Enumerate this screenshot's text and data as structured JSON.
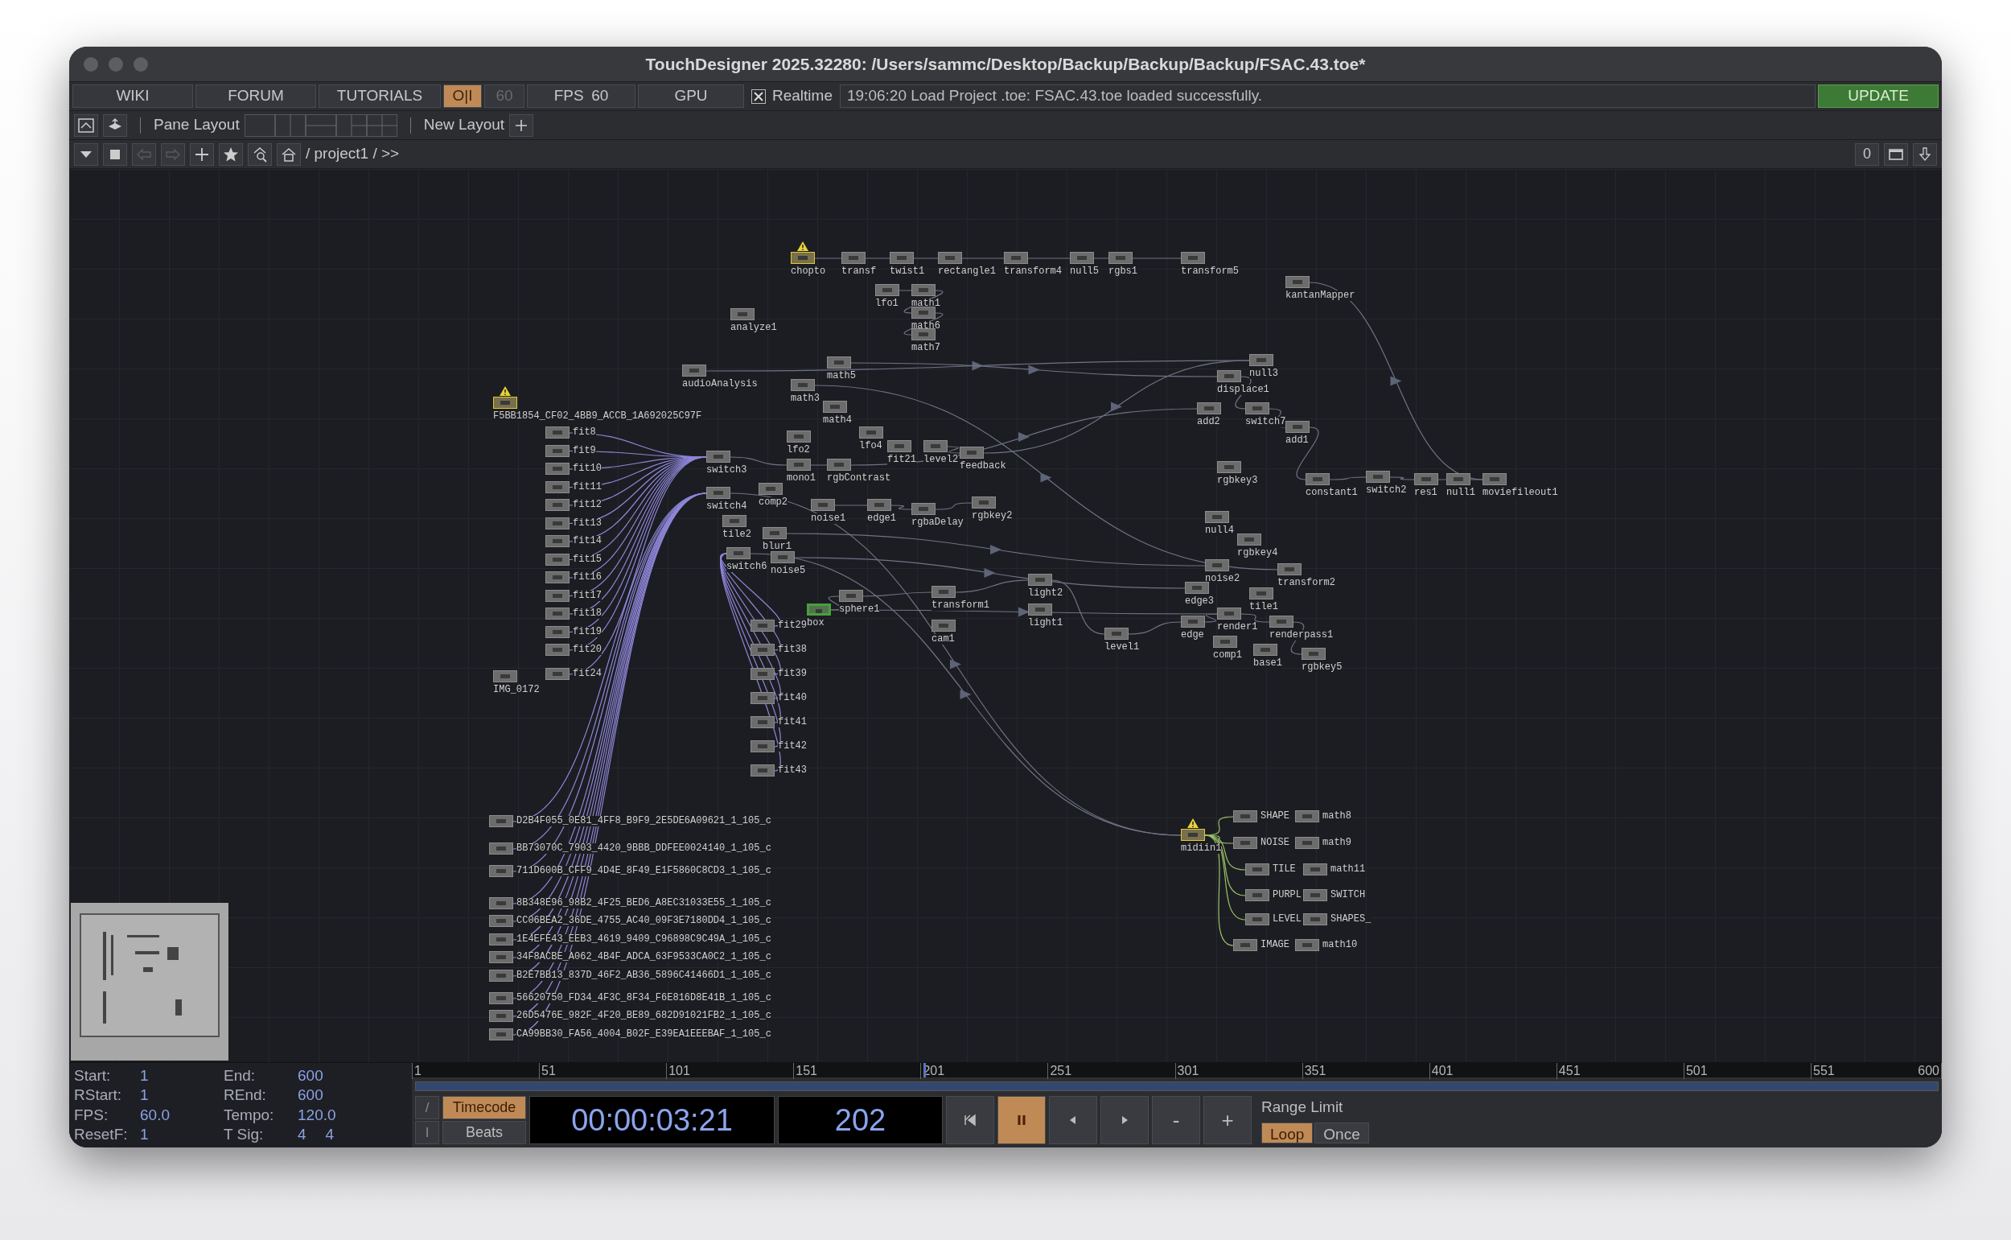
{
  "window": {
    "title": "TouchDesigner 2025.32280: /Users/sammc/Desktop/Backup/Backup/Backup/FSAC.43.toe*"
  },
  "toolbar": {
    "links": [
      "WIKI",
      "FORUM",
      "TUTORIALS"
    ],
    "perform_toggle": {
      "label": "O|I",
      "on": true
    },
    "frame_rate_field": {
      "value": "60",
      "disabled": true
    },
    "fps": {
      "label": "FPS",
      "value": "60"
    },
    "gpu": {
      "label": "GPU"
    },
    "realtime": {
      "label": "Realtime",
      "checked": true
    },
    "message": "19:06:20 Load Project .toe: FSAC.43.toe loaded successfully.",
    "update_button": {
      "label": "UPDATE"
    }
  },
  "pane_bar": {
    "label": "Pane Layout",
    "new_layout": "New Layout"
  },
  "path_bar": {
    "path": "/ project1 / >>",
    "back_disabled": true,
    "forward_disabled": true,
    "counter": "0"
  },
  "graph": {
    "nodes": [
      {
        "label": "chopto",
        "warning": true,
        "selected": false
      },
      {
        "label": "transf",
        "warning": false,
        "selected": false
      },
      {
        "label": "twist1",
        "warning": false,
        "selected": false
      },
      {
        "label": "rectangle1",
        "warning": false,
        "selected": false
      },
      {
        "label": "transform4",
        "warning": false,
        "selected": false
      },
      {
        "label": "null5",
        "warning": false,
        "selected": false
      },
      {
        "label": "rgbs1",
        "warning": false,
        "selected": false
      },
      {
        "label": "transform5",
        "warning": false,
        "selected": false
      },
      {
        "label": "kantanMapper",
        "warning": false,
        "selected": false
      },
      {
        "label": "lfo1",
        "warning": false,
        "selected": false
      },
      {
        "label": "math1",
        "warning": false,
        "selected": false
      },
      {
        "label": "math6",
        "warning": false,
        "selected": false
      },
      {
        "label": "math7",
        "warning": false,
        "selected": false
      },
      {
        "label": "analyze1",
        "warning": false,
        "selected": false
      },
      {
        "label": "audioAnalysis",
        "warning": false,
        "selected": false
      },
      {
        "label": "math5",
        "warning": false,
        "selected": false
      },
      {
        "label": "math3",
        "warning": false,
        "selected": false
      },
      {
        "label": "math4",
        "warning": false,
        "selected": false
      },
      {
        "label": "lfo2",
        "warning": false,
        "selected": false
      },
      {
        "label": "lfo4",
        "warning": false,
        "selected": false
      },
      {
        "label": "fit21",
        "warning": false,
        "selected": false
      },
      {
        "label": "level2",
        "warning": false,
        "selected": false
      },
      {
        "label": "feedback",
        "warning": false,
        "selected": false
      },
      {
        "label": "switch3",
        "warning": false,
        "selected": false
      },
      {
        "label": "mono1",
        "warning": false,
        "selected": false
      },
      {
        "label": "rgbContrast",
        "warning": false,
        "selected": false
      },
      {
        "label": "switch4",
        "warning": false,
        "selected": false
      },
      {
        "label": "comp2",
        "warning": false,
        "selected": false
      },
      {
        "label": "tile2",
        "warning": false,
        "selected": false
      },
      {
        "label": "noise1",
        "warning": false,
        "selected": false
      },
      {
        "label": "edge1",
        "warning": false,
        "selected": false
      },
      {
        "label": "rgbaDelay",
        "warning": false,
        "selected": false
      },
      {
        "label": "rgbkey2",
        "warning": false,
        "selected": false
      },
      {
        "label": "blur1",
        "warning": false,
        "selected": false
      },
      {
        "label": "switch6",
        "warning": false,
        "selected": false
      },
      {
        "label": "noise5",
        "warning": false,
        "selected": false
      },
      {
        "label": "box",
        "warning": false,
        "selected": true
      },
      {
        "label": "sphere1",
        "warning": false,
        "selected": false
      },
      {
        "label": "transform1",
        "warning": false,
        "selected": false
      },
      {
        "label": "cam1",
        "warning": false,
        "selected": false
      },
      {
        "label": "light2",
        "warning": false,
        "selected": false
      },
      {
        "label": "light1",
        "warning": false,
        "selected": false
      },
      {
        "label": "level1",
        "warning": false,
        "selected": false
      },
      {
        "label": "null3",
        "warning": false,
        "selected": false
      },
      {
        "label": "displace1",
        "warning": false,
        "selected": false
      },
      {
        "label": "add2",
        "warning": false,
        "selected": false
      },
      {
        "label": "switch7",
        "warning": false,
        "selected": false
      },
      {
        "label": "add1",
        "warning": false,
        "selected": false
      },
      {
        "label": "rgbkey3",
        "warning": false,
        "selected": false
      },
      {
        "label": "constant1",
        "warning": false,
        "selected": false
      },
      {
        "label": "switch2",
        "warning": false,
        "selected": false
      },
      {
        "label": "res1",
        "warning": false,
        "selected": false
      },
      {
        "label": "null1",
        "warning": false,
        "selected": false
      },
      {
        "label": "moviefileout1",
        "warning": false,
        "selected": false
      },
      {
        "label": "null4",
        "warning": false,
        "selected": false
      },
      {
        "label": "rgbkey4",
        "warning": false,
        "selected": false
      },
      {
        "label": "noise2",
        "warning": false,
        "selected": false
      },
      {
        "label": "transform2",
        "warning": false,
        "selected": false
      },
      {
        "label": "edge3",
        "warning": false,
        "selected": false
      },
      {
        "label": "tile1",
        "warning": false,
        "selected": false
      },
      {
        "label": "render1",
        "warning": false,
        "selected": false
      },
      {
        "label": "edge",
        "warning": false,
        "selected": false
      },
      {
        "label": "renderpass1",
        "warning": false,
        "selected": false
      },
      {
        "label": "comp1",
        "warning": false,
        "selected": false
      },
      {
        "label": "base1",
        "warning": false,
        "selected": false
      },
      {
        "label": "rgbkey5",
        "warning": false,
        "selected": false
      },
      {
        "label": "F5BB1854_CF02_4BB9_ACCB_1A692025C97F",
        "warning": true,
        "selected": false
      },
      {
        "label": "fit8",
        "warning": false,
        "selected": false
      },
      {
        "label": "fit9",
        "warning": false,
        "selected": false
      },
      {
        "label": "fit10",
        "warning": false,
        "selected": false
      },
      {
        "label": "fit11",
        "warning": false,
        "selected": false
      },
      {
        "label": "fit12",
        "warning": false,
        "selected": false
      },
      {
        "label": "fit13",
        "warning": false,
        "selected": false
      },
      {
        "label": "fit14",
        "warning": false,
        "selected": false
      },
      {
        "label": "fit15",
        "warning": false,
        "selected": false
      },
      {
        "label": "fit16",
        "warning": false,
        "selected": false
      },
      {
        "label": "fit17",
        "warning": false,
        "selected": false
      },
      {
        "label": "fit18",
        "warning": false,
        "selected": false
      },
      {
        "label": "fit19",
        "warning": false,
        "selected": false
      },
      {
        "label": "fit20",
        "warning": false,
        "selected": false
      },
      {
        "label": "fit24",
        "warning": false,
        "selected": false
      },
      {
        "label": "IMG_0172",
        "warning": false,
        "selected": false
      },
      {
        "label": "fit29",
        "warning": false,
        "selected": false
      },
      {
        "label": "fit38",
        "warning": false,
        "selected": false
      },
      {
        "label": "fit39",
        "warning": false,
        "selected": false
      },
      {
        "label": "fit40",
        "warning": false,
        "selected": false
      },
      {
        "label": "fit41",
        "warning": false,
        "selected": false
      },
      {
        "label": "fit42",
        "warning": false,
        "selected": false
      },
      {
        "label": "fit43",
        "warning": false,
        "selected": false
      },
      {
        "label": "D2B4F055_0E81_4FF8_B9F9_2E5DE6A09621_1_105_c",
        "warning": false,
        "selected": false
      },
      {
        "label": "BB73070C_7903_4420_9BBB_DDFEE0024140_1_105_c",
        "warning": false,
        "selected": false
      },
      {
        "label": "711D600B_CFF9_4D4E_8F49_E1F5860C8CD3_1_105_c",
        "warning": false,
        "selected": false
      },
      {
        "label": "8B348E96_98B2_4F25_BED6_A8EC31033E55_1_105_c",
        "warning": false,
        "selected": false
      },
      {
        "label": "CC06BEA2_36DE_4755_AC40_09F3E7180DD4_1_105_c",
        "warning": false,
        "selected": false
      },
      {
        "label": "1E4EFE43_EEB3_4619_9409_C96898C9C49A_1_105_c",
        "warning": false,
        "selected": false
      },
      {
        "label": "34F8ACBE_A062_4B4F_ADCA_63F9533CA0C2_1_105_c",
        "warning": false,
        "selected": false
      },
      {
        "label": "B2E7BB13_837D_46F2_AB36_5896C41466D1_1_105_c",
        "warning": false,
        "selected": false
      },
      {
        "label": "56620750_FD34_4F3C_8F34_F6E816D8E41B_1_105_c",
        "warning": false,
        "selected": false
      },
      {
        "label": "26D5476E_982F_4F20_BE89_682D91021FB2_1_105_c",
        "warning": false,
        "selected": false
      },
      {
        "label": "CA99BB30_FA56_4004_B02F_E39EA1EEEBAF_1_105_c",
        "warning": false,
        "selected": false
      },
      {
        "label": "midiin1",
        "warning": true,
        "selected": false
      },
      {
        "label": "SHAPE",
        "warning": false,
        "selected": false
      },
      {
        "label": "math8",
        "warning": false,
        "selected": false
      },
      {
        "label": "NOISE",
        "warning": false,
        "selected": false
      },
      {
        "label": "math9",
        "warning": false,
        "selected": false
      },
      {
        "label": "TILE",
        "warning": false,
        "selected": false
      },
      {
        "label": "math11",
        "warning": false,
        "selected": false
      },
      {
        "label": "PURPL",
        "warning": false,
        "selected": false
      },
      {
        "label": "SWITCH",
        "warning": false,
        "selected": false
      },
      {
        "label": "LEVEL",
        "warning": false,
        "selected": false
      },
      {
        "label": "SHAPES_",
        "warning": false,
        "selected": false
      },
      {
        "label": "IMAGE",
        "warning": false,
        "selected": false
      },
      {
        "label": "math10",
        "warning": false,
        "selected": false
      }
    ]
  },
  "info": [
    {
      "label": "Start:",
      "values": [
        "1"
      ]
    },
    {
      "label": "End:",
      "values": [
        "600"
      ]
    },
    {
      "label": "RStart:",
      "values": [
        "1"
      ]
    },
    {
      "label": "REnd:",
      "values": [
        "600"
      ]
    },
    {
      "label": "FPS:",
      "values": [
        "60.0"
      ]
    },
    {
      "label": "Tempo:",
      "values": [
        "120.0"
      ]
    },
    {
      "label": "ResetF:",
      "values": [
        "1"
      ]
    },
    {
      "label": "T Sig:",
      "values": [
        "4",
        "4"
      ]
    }
  ],
  "timeline": {
    "ticks": [
      "1",
      "51",
      "101",
      "151",
      "201",
      "251",
      "301",
      "351",
      "401",
      "451",
      "501",
      "551",
      "600"
    ],
    "playhead": {
      "level": 0.3356
    },
    "side_buttons": [
      "/",
      "I"
    ],
    "modes": [
      {
        "label": "Timecode",
        "selected": true
      },
      {
        "label": "Beats",
        "selected": false
      }
    ],
    "timecode": "00:00:03:21",
    "frame": "202",
    "transport": [
      {
        "kind": "rewind",
        "active": false
      },
      {
        "kind": "pause",
        "active": true
      },
      {
        "kind": "back",
        "active": false
      },
      {
        "kind": "forward",
        "active": false
      },
      {
        "kind": "text",
        "label": "-",
        "active": false
      },
      {
        "kind": "text",
        "label": "+",
        "active": false
      }
    ],
    "range_limit": {
      "label": "Range Limit",
      "options": [
        {
          "label": "Loop",
          "selected": true
        },
        {
          "label": "Once",
          "selected": false
        }
      ]
    }
  }
}
